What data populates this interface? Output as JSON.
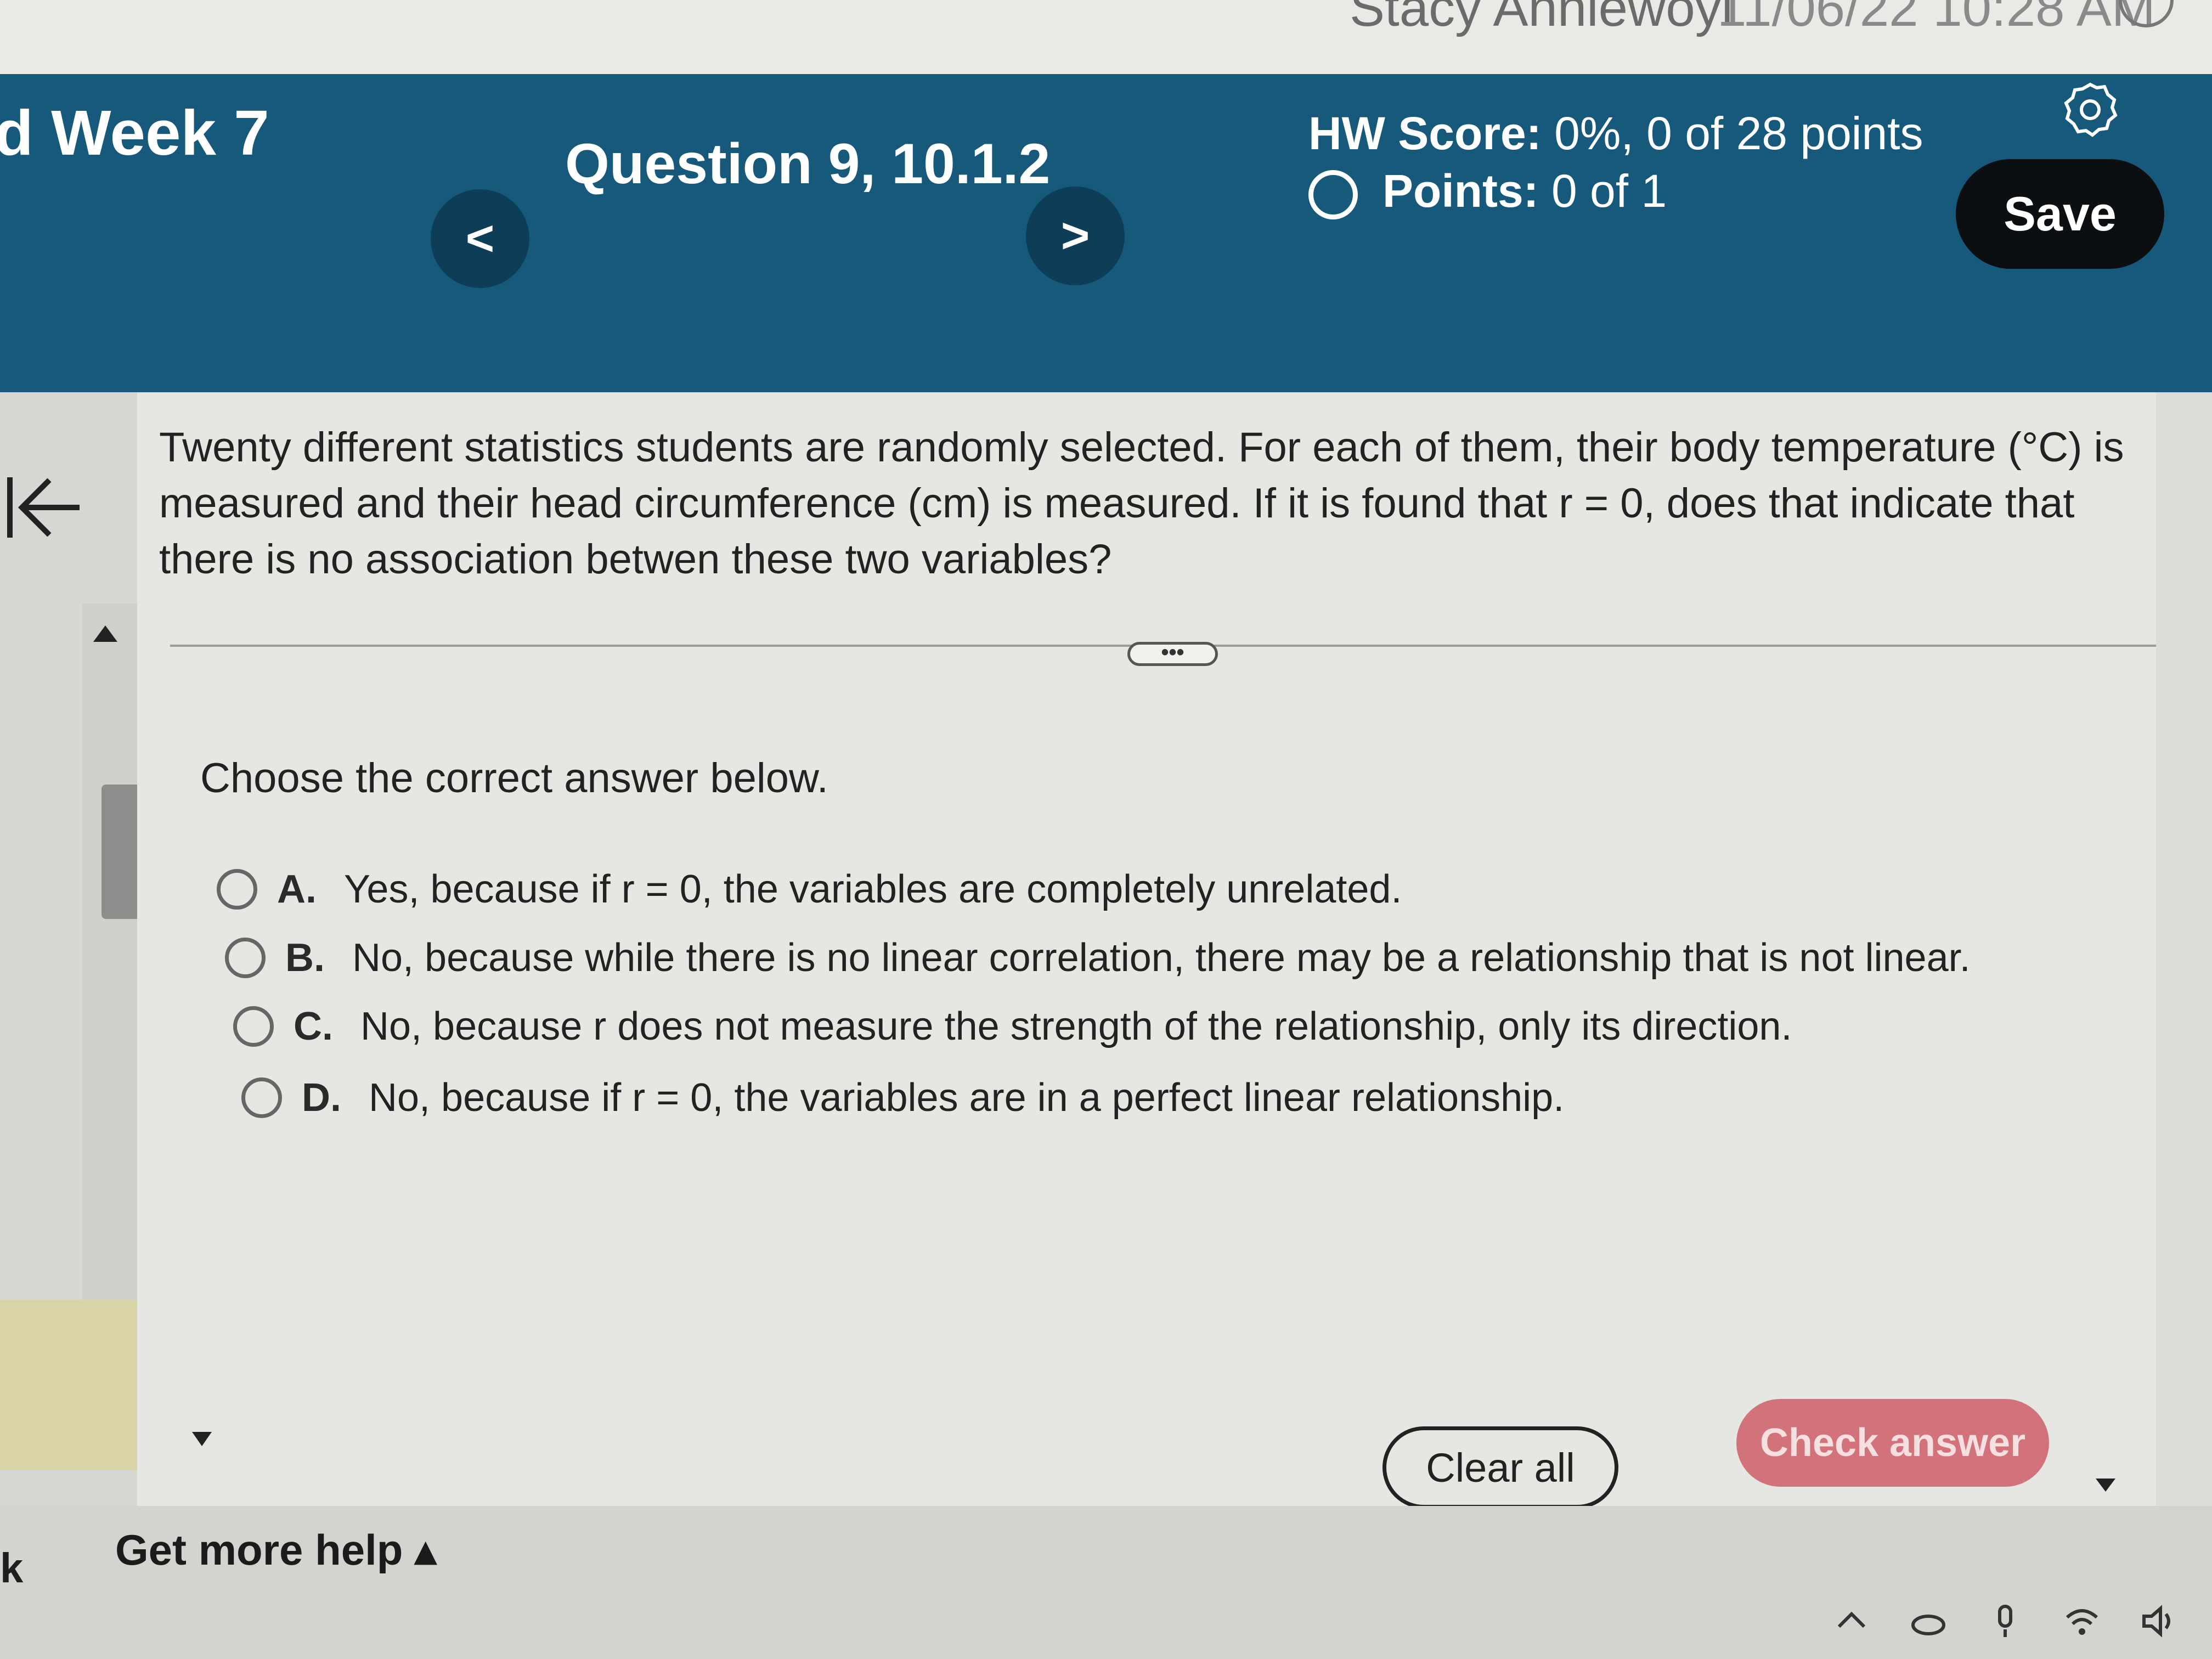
{
  "system": {
    "user": "Stacy Anniewoyi",
    "datetime": "11/06/22 10:28 AM"
  },
  "header": {
    "course_title": "d Week 7",
    "question_title": "Question 9, 10.1.2",
    "prev_label": "<",
    "next_label": ">",
    "hw_score_label": "HW Score:",
    "hw_score_value": "0%, 0 of 28 points",
    "points_label": "Points:",
    "points_value": "0 of 1",
    "save_label": "Save"
  },
  "question": {
    "text": "Twenty different statistics students are randomly selected. For each of them, their body temperature (°C) is measured and their head circumference (cm) is measured. If it is found that r = 0, does that indicate that there is no association betwen these two variables?",
    "more_label": "•••",
    "prompt": "Choose the correct answer below.",
    "options": [
      {
        "letter": "A.",
        "text": "Yes, because if r = 0, the variables are completely unrelated."
      },
      {
        "letter": "B.",
        "text": "No, because while there is no linear correlation, there may be a relationship that is not linear."
      },
      {
        "letter": "C.",
        "text": "No, because r does not measure the strength of the relationship, only its direction."
      },
      {
        "letter": "D.",
        "text": "No, because if r = 0, the variables are in a perfect linear relationship."
      }
    ]
  },
  "actions": {
    "clear_label": "Clear all",
    "check_label": "Check answer"
  },
  "footer": {
    "left_fragment": "k",
    "more_help_label": "Get more help ▴"
  },
  "colors": {
    "header_bg": "#16597a",
    "nav_button_bg": "#0e3e57",
    "save_bg": "#0b0f12",
    "check_bg": "#d2737c"
  }
}
